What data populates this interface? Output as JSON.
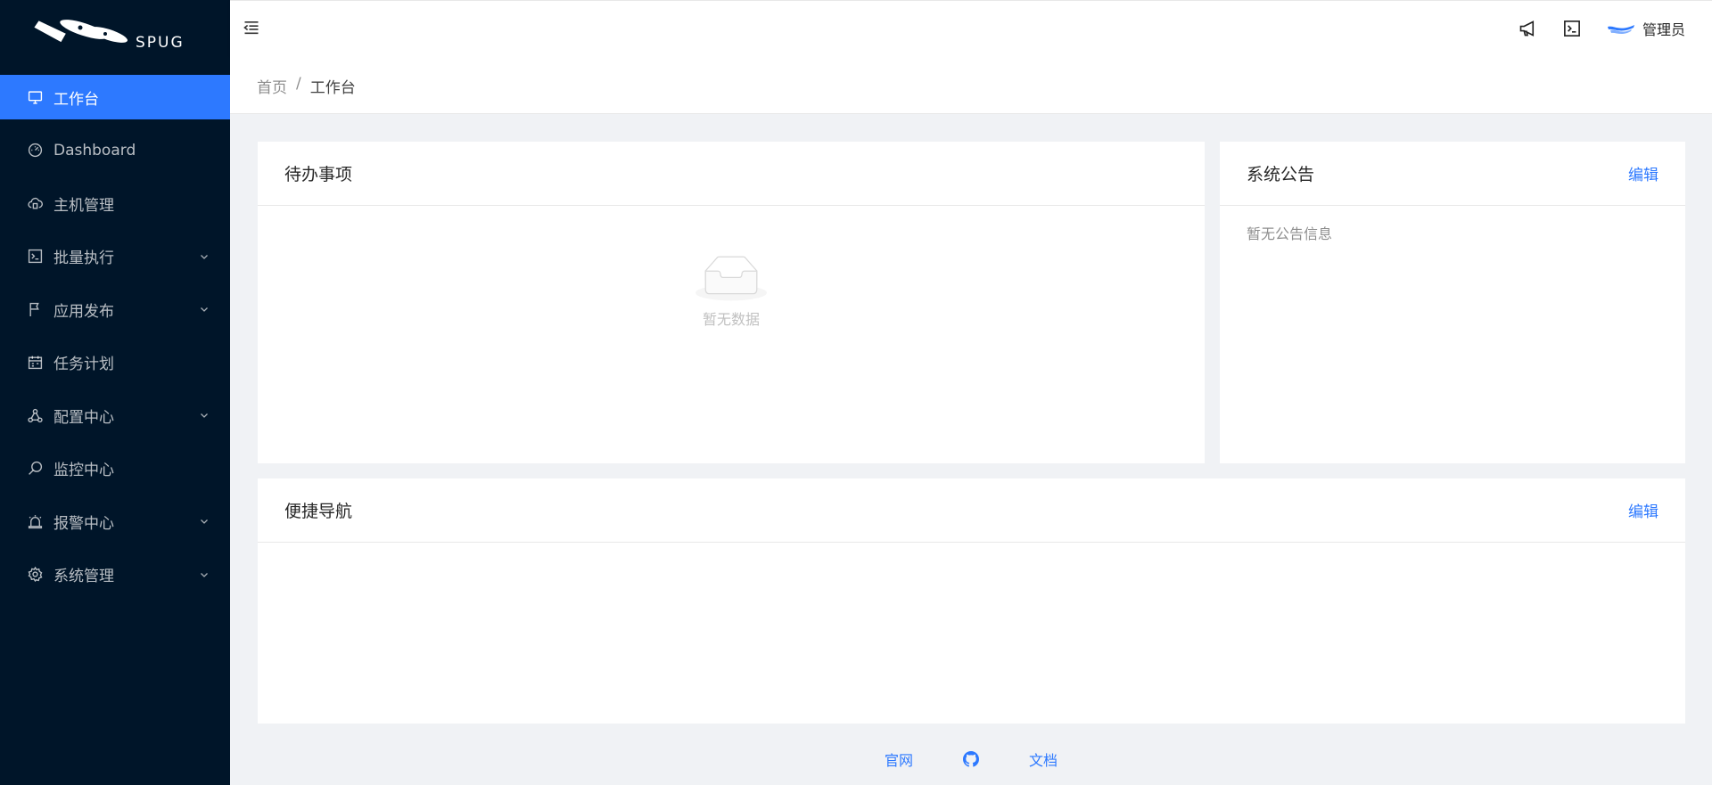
{
  "app": {
    "brand": "SPUG"
  },
  "colors": {
    "sidebar_bg": "#001529",
    "accent": "#2d79ff"
  },
  "sidebar": {
    "items": [
      {
        "label": "工作台",
        "icon": "desktop-icon",
        "active": true,
        "has_children": false
      },
      {
        "label": "Dashboard",
        "icon": "dashboard-icon",
        "active": false,
        "has_children": false
      },
      {
        "label": "主机管理",
        "icon": "cloud-server-icon",
        "active": false,
        "has_children": false
      },
      {
        "label": "批量执行",
        "icon": "code-icon",
        "active": false,
        "has_children": true
      },
      {
        "label": "应用发布",
        "icon": "flag-icon",
        "active": false,
        "has_children": true
      },
      {
        "label": "任务计划",
        "icon": "schedule-icon",
        "active": false,
        "has_children": false
      },
      {
        "label": "配置中心",
        "icon": "deployment-unit-icon",
        "active": false,
        "has_children": true
      },
      {
        "label": "监控中心",
        "icon": "monitor-icon",
        "active": false,
        "has_children": false
      },
      {
        "label": "报警中心",
        "icon": "alert-icon",
        "active": false,
        "has_children": true
      },
      {
        "label": "系统管理",
        "icon": "setting-icon",
        "active": false,
        "has_children": true
      }
    ]
  },
  "header": {
    "notification_icon": "notification-icon",
    "terminal_icon": "terminal-icon",
    "user_name": "管理员"
  },
  "breadcrumb": {
    "home": "首页",
    "separator": "/",
    "current": "工作台"
  },
  "todo": {
    "title": "待办事项",
    "empty_text": "暂无数据"
  },
  "notice": {
    "title": "系统公告",
    "edit_label": "编辑",
    "empty_text": "暂无公告信息"
  },
  "nav": {
    "title": "便捷导航",
    "edit_label": "编辑"
  },
  "footer": {
    "links": [
      "官网",
      "文档"
    ],
    "github_icon": "github-icon"
  }
}
